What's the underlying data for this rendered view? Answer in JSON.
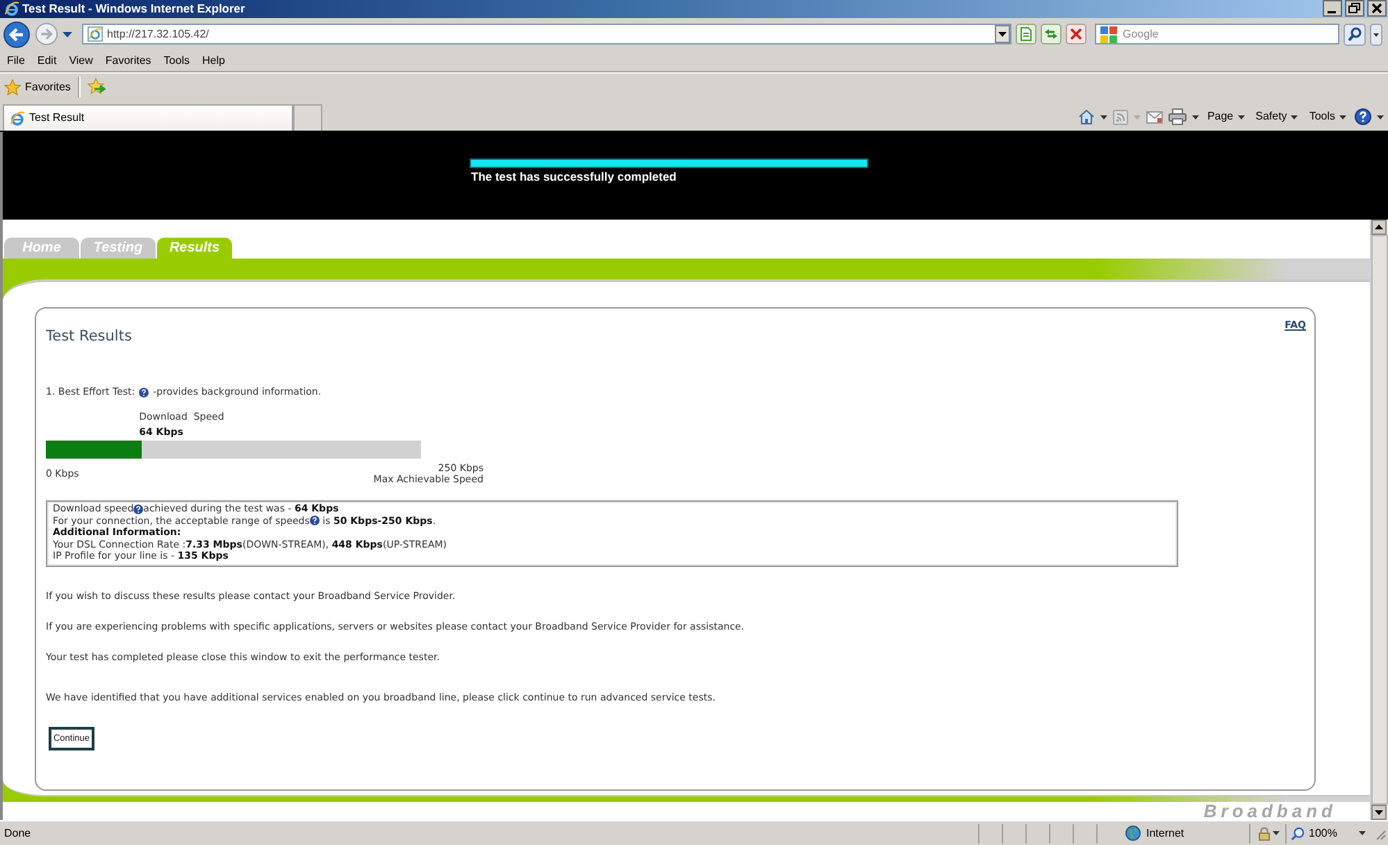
{
  "window": {
    "title": "Test Result - Windows Internet Explorer"
  },
  "address_bar": {
    "url": "http://217.32.105.42/",
    "search_placeholder": "Google"
  },
  "menu": [
    "File",
    "Edit",
    "View",
    "Favorites",
    "Tools",
    "Help"
  ],
  "favorites_bar": {
    "label": "Favorites"
  },
  "browser_tabs": [
    {
      "label": "Test Result",
      "selected": true
    }
  ],
  "command_bar": [
    "Page",
    "Safety",
    "Tools"
  ],
  "page": {
    "header": {
      "progress": {
        "level": 1,
        "caption": "The test has successfully completed"
      }
    },
    "nav_tabs": [
      {
        "label": "Home",
        "selected": false
      },
      {
        "label": "Testing",
        "selected": false
      },
      {
        "label": "Results",
        "selected": true
      }
    ],
    "results": {
      "title": "Test Results",
      "faq_link": "FAQ",
      "test_line": {
        "before": "1. Best Effort Test:",
        "after": "-provides background information."
      },
      "meter": {
        "label": "Download  Speed",
        "value": "64 Kbps",
        "level": 0.256,
        "min_label": "0 Kbps",
        "max_value": "250 Kbps",
        "max_label": "Max Achievable Speed"
      },
      "info_lines": [
        {
          "kind": "help",
          "before": "Download speed",
          "after": "achieved during the test was - **64 Kbps**"
        },
        {
          "kind": "help",
          "before": "For your connection, the acceptable range of speeds",
          "after": " is **50 Kbps-250 Kbps**."
        },
        {
          "kind": "heading",
          "text": "Additional Information:"
        },
        {
          "kind": "plain",
          "text": "Your DSL Connection Rate :**7.33 Mbps**(DOWN-STREAM), **448 Kbps**(UP-STREAM)"
        },
        {
          "kind": "plain",
          "text": "IP Profile for your line is - **135 Kbps**"
        }
      ],
      "paragraphs": [
        "If you wish to discuss these results please contact your Broadband Service Provider.",
        "If you are experiencing problems with specific applications, servers or websites please contact your Broadband Service Provider for assistance.",
        "Your test has completed please close this window to exit the performance tester.",
        "We have identified that you have additional services enabled on you broadband line, please click continue to run advanced service tests."
      ],
      "continue_button": "Continue"
    },
    "brand_text": "Broadband"
  },
  "status_bar": {
    "text": "Done",
    "zone": "Internet",
    "zoom": "100%"
  }
}
